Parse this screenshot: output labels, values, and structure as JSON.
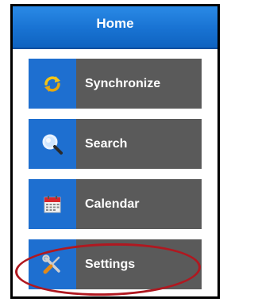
{
  "header": {
    "title": "Home"
  },
  "menu": {
    "items": [
      {
        "label": "Synchronize",
        "icon": "sync-icon"
      },
      {
        "label": "Search",
        "icon": "magnifier-icon"
      },
      {
        "label": "Calendar",
        "icon": "calendar-icon"
      },
      {
        "label": "Settings",
        "icon": "tools-icon"
      }
    ]
  },
  "colors": {
    "header_blue": "#1872d2",
    "icon_tile_blue": "#1e6fd0",
    "button_gray": "#5a5a5a",
    "highlight_red": "#b01820"
  }
}
